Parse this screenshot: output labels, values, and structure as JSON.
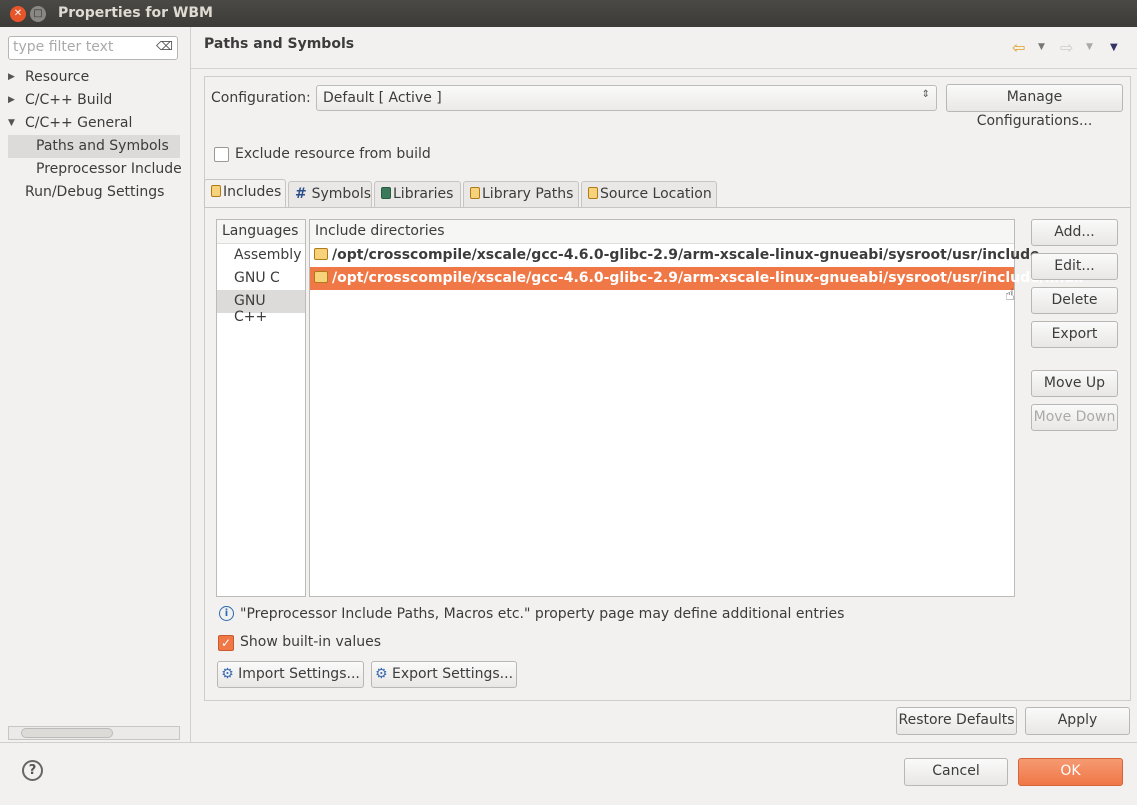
{
  "window": {
    "title": "Properties for WBM"
  },
  "sidebar": {
    "filter_placeholder": "type filter text",
    "items": [
      {
        "label": "Resource",
        "expander": "collapsed"
      },
      {
        "label": "C/C++ Build",
        "expander": "collapsed"
      },
      {
        "label": "C/C++ General",
        "expander": "expanded"
      },
      {
        "label": "Paths and Symbols",
        "selected": true
      },
      {
        "label": "Preprocessor Include"
      },
      {
        "label": "Run/Debug Settings",
        "expander": "none"
      }
    ]
  },
  "page": {
    "title": "Paths and Symbols",
    "configuration_label": "Configuration:",
    "configuration_value": "Default  [ Active ]",
    "manage_button": "Manage Configurations...",
    "exclude_label": "Exclude resource from build",
    "exclude_checked": false,
    "tabs": [
      {
        "label": "Includes",
        "icon": "includes-icon"
      },
      {
        "label": "Symbols",
        "icon": "#"
      },
      {
        "label": "Libraries",
        "icon": "libraries-icon"
      },
      {
        "label": "Library Paths",
        "icon": "library-paths-icon"
      },
      {
        "label": "Source Location",
        "icon": "source-location-icon"
      }
    ],
    "languages_header": "Languages",
    "languages": [
      "Assembly",
      "GNU C",
      "GNU C++"
    ],
    "include_header": "Include directories",
    "includes": [
      "/opt/crosscompile/xscale/gcc-4.6.0-glibc-2.9/arm-xscale-linux-gnueabi/sysroot/usr/include",
      "/opt/crosscompile/xscale/gcc-4.6.0-glibc-2.9/arm-xscale-linux-gnueabi/sysroot/usr/include/linux"
    ],
    "side_buttons": {
      "add": "Add...",
      "edit": "Edit...",
      "delete": "Delete",
      "export": "Export",
      "move_up": "Move Up",
      "move_down": "Move Down"
    },
    "info_text": "\"Preprocessor Include Paths, Macros etc.\" property page may define additional entries",
    "show_builtin_label": "Show built-in values",
    "show_builtin_checked": true,
    "import_settings": "Import Settings...",
    "export_settings": "Export Settings...",
    "restore_defaults": "Restore Defaults",
    "apply": "Apply"
  },
  "footer": {
    "cancel": "Cancel",
    "ok": "OK",
    "help": "?"
  },
  "colors": {
    "accent": "#f07746",
    "selection": "#f07746"
  }
}
